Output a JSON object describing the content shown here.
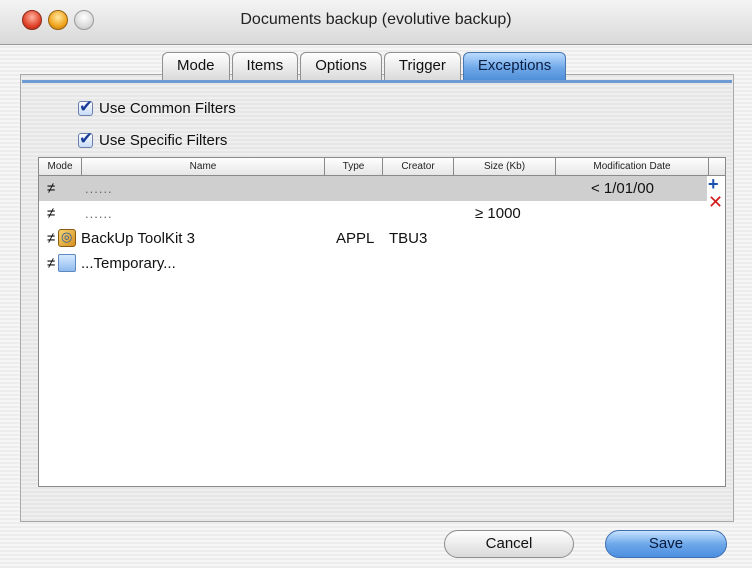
{
  "window": {
    "title": "Documents backup (evolutive backup)"
  },
  "tabs": [
    {
      "label": "Mode",
      "active": false
    },
    {
      "label": "Items",
      "active": false
    },
    {
      "label": "Options",
      "active": false
    },
    {
      "label": "Trigger",
      "active": false
    },
    {
      "label": "Exceptions",
      "active": true
    }
  ],
  "filters": {
    "common": {
      "label": "Use Common Filters",
      "checked": true
    },
    "specific": {
      "label": "Use Specific Filters",
      "checked": true
    }
  },
  "table": {
    "columns": [
      "Mode",
      "Name",
      "Type",
      "Creator",
      "Size (Kb)",
      "Modification Date"
    ],
    "rows": [
      {
        "mode": "≠",
        "icon": "",
        "name": "......",
        "type": "",
        "creator": "",
        "size": "",
        "date": "< 1/01/00",
        "selected": true
      },
      {
        "mode": "≠",
        "icon": "",
        "name": "......",
        "type": "",
        "creator": "",
        "size": "≥ 1000",
        "date": "",
        "selected": false
      },
      {
        "mode": "≠",
        "icon": "application-icon",
        "name": "BackUp ToolKit 3",
        "type": "APPL",
        "creator": "TBU3",
        "size": "",
        "date": "",
        "selected": false
      },
      {
        "mode": "≠",
        "icon": "folder-icon",
        "name": "...Temporary...",
        "type": "",
        "creator": "",
        "size": "",
        "date": "",
        "selected": false
      }
    ],
    "add_symbol": "+",
    "remove_symbol": "✕"
  },
  "buttons": {
    "cancel": "Cancel",
    "save": "Save"
  },
  "colors": {
    "accent": "#4f8fd8",
    "selected_row": "#cfcfcf",
    "add": "#1a4fb0",
    "remove": "#d21a1a"
  }
}
